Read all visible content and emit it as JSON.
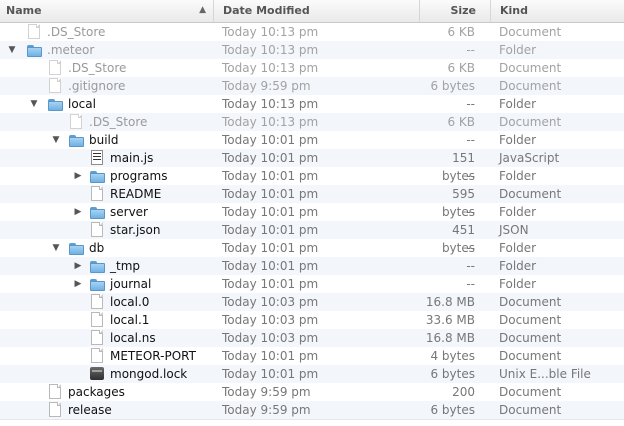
{
  "columns": {
    "name": "Name",
    "date": "Date Modified",
    "size": "Size",
    "kind": "Kind"
  },
  "sort_indicator": "▲",
  "rows": [
    {
      "name": ".DS_Store",
      "date": "Today 10:13 pm",
      "size": "6 KB",
      "kind": "Document",
      "icon": "document-icon",
      "disclosure": "",
      "dim": true
    },
    {
      "name": ".meteor",
      "date": "Today 10:13 pm",
      "size": "--",
      "kind": "Folder",
      "icon": "folder-icon",
      "disclosure": "▼",
      "dim": true
    },
    {
      "name": ".DS_Store",
      "date": "Today 10:13 pm",
      "size": "6 KB",
      "kind": "Document",
      "icon": "document-icon",
      "disclosure": "",
      "dim": true
    },
    {
      "name": ".gitignore",
      "date": "Today 9:59 pm",
      "size": "6 bytes",
      "kind": "Document",
      "icon": "document-icon",
      "disclosure": "",
      "dim": true
    },
    {
      "name": "local",
      "date": "Today 10:13 pm",
      "size": "--",
      "kind": "Folder",
      "icon": "folder-icon",
      "disclosure": "▼",
      "dim": false
    },
    {
      "name": ".DS_Store",
      "date": "Today 10:13 pm",
      "size": "6 KB",
      "kind": "Document",
      "icon": "document-icon",
      "disclosure": "",
      "dim": true
    },
    {
      "name": "build",
      "date": "Today 10:01 pm",
      "size": "--",
      "kind": "Folder",
      "icon": "folder-icon",
      "disclosure": "▼",
      "dim": false
    },
    {
      "name": "main.js",
      "date": "Today 10:01 pm",
      "size": "151 bytes",
      "kind": "JavaScript",
      "icon": "javascript-file-icon",
      "disclosure": "",
      "dim": false
    },
    {
      "name": "programs",
      "date": "Today 10:01 pm",
      "size": "--",
      "kind": "Folder",
      "icon": "folder-icon",
      "disclosure": "▶",
      "dim": false
    },
    {
      "name": "README",
      "date": "Today 10:01 pm",
      "size": "595 bytes",
      "kind": "Document",
      "icon": "document-icon",
      "disclosure": "",
      "dim": false
    },
    {
      "name": "server",
      "date": "Today 10:01 pm",
      "size": "--",
      "kind": "Folder",
      "icon": "folder-icon",
      "disclosure": "▶",
      "dim": false
    },
    {
      "name": "star.json",
      "date": "Today 10:01 pm",
      "size": "451 bytes",
      "kind": "JSON",
      "icon": "document-icon",
      "disclosure": "",
      "dim": false
    },
    {
      "name": "db",
      "date": "Today 10:01 pm",
      "size": "--",
      "kind": "Folder",
      "icon": "folder-icon",
      "disclosure": "▼",
      "dim": false
    },
    {
      "name": "_tmp",
      "date": "Today 10:01 pm",
      "size": "--",
      "kind": "Folder",
      "icon": "folder-icon",
      "disclosure": "▶",
      "dim": false
    },
    {
      "name": "journal",
      "date": "Today 10:01 pm",
      "size": "--",
      "kind": "Folder",
      "icon": "folder-icon",
      "disclosure": "▶",
      "dim": false
    },
    {
      "name": "local.0",
      "date": "Today 10:03 pm",
      "size": "16.8 MB",
      "kind": "Document",
      "icon": "document-icon",
      "disclosure": "",
      "dim": false
    },
    {
      "name": "local.1",
      "date": "Today 10:03 pm",
      "size": "33.6 MB",
      "kind": "Document",
      "icon": "document-icon",
      "disclosure": "",
      "dim": false
    },
    {
      "name": "local.ns",
      "date": "Today 10:03 pm",
      "size": "16.8 MB",
      "kind": "Document",
      "icon": "document-icon",
      "disclosure": "",
      "dim": false
    },
    {
      "name": "METEOR-PORT",
      "date": "Today 10:01 pm",
      "size": "4 bytes",
      "kind": "Document",
      "icon": "document-icon",
      "disclosure": "",
      "dim": false
    },
    {
      "name": "mongod.lock",
      "date": "Today 10:01 pm",
      "size": "6 bytes",
      "kind": "Unix E...ble File",
      "icon": "executable-icon",
      "disclosure": "",
      "dim": false
    },
    {
      "name": "packages",
      "date": "Today 9:59 pm",
      "size": "200 bytes",
      "kind": "Document",
      "icon": "document-icon",
      "disclosure": "",
      "dim": false
    },
    {
      "name": "release",
      "date": "Today 9:59 pm",
      "size": "6 bytes",
      "kind": "Document",
      "icon": "document-icon",
      "disclosure": "",
      "dim": false
    }
  ]
}
